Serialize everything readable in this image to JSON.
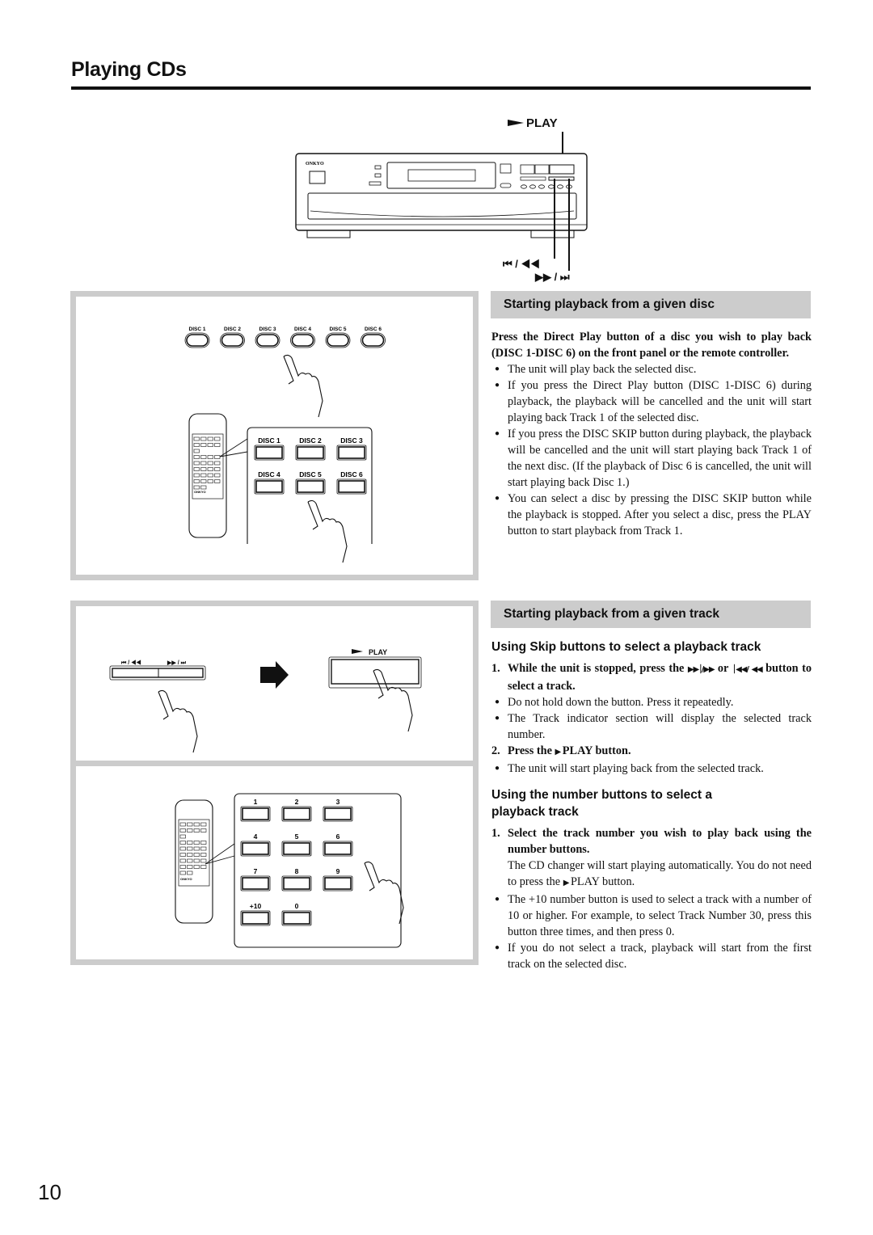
{
  "page": {
    "title": "Playing CDs",
    "page_number": "10"
  },
  "top_figure": {
    "brand": "ONKYO",
    "play_label": "PLAY",
    "prev_label": "⏮ / ◀◀",
    "next_label": "▶▶ / ⏭",
    "icons": [
      "play-icon",
      "skip-back-icon",
      "rewind-icon",
      "fast-forward-icon",
      "skip-forward-icon"
    ]
  },
  "disc_figure": {
    "front_panel_buttons": [
      "DISC 1",
      "DISC 2",
      "DISC 3",
      "DISC 4",
      "DISC 5",
      "DISC 6"
    ],
    "remote_buttons": [
      "DISC 1",
      "DISC 2",
      "DISC 3",
      "DISC 4",
      "DISC 5",
      "DISC 6"
    ],
    "remote_brand": "ONKYO"
  },
  "skip_figure": {
    "prev_label": "⏮ / ◀◀",
    "next_label": "▶▶ / ⏭",
    "play_label": "PLAY"
  },
  "number_figure": {
    "buttons": [
      "1",
      "2",
      "3",
      "4",
      "5",
      "6",
      "7",
      "8",
      "9",
      "+10",
      "0"
    ],
    "remote_brand": "ONKYO"
  },
  "section_disc": {
    "heading": "Starting playback from a given disc",
    "intro": "Press the Direct Play button of a disc you wish to play back (DISC 1-DISC 6) on the front panel or the remote controller.",
    "bullets": [
      "The unit will play back the selected disc.",
      "If you press the Direct Play button (DISC 1-DISC 6) during playback, the playback will be cancelled and the unit will start playing back Track 1 of the selected disc.",
      "If you press the DISC SKIP button during playback, the playback will be cancelled and the unit will start playing back Track 1 of the next disc. (If the playback of Disc 6 is cancelled, the unit will start playing back Disc 1.)",
      "You can select a disc by pressing the DISC SKIP button while the playback is stopped. After you select a disc, press the PLAY button to start playback from Track 1."
    ]
  },
  "section_track": {
    "heading": "Starting playback from a given track",
    "skip_sub": {
      "heading": "Using Skip buttons to select a playback track",
      "step1_num": "1.",
      "step1_a": "While the unit is stopped, press the",
      "step1_glyph1": "▶▶⏐/▶▶",
      "step1_or": "or",
      "step1_glyph2": "⏐◀◀/",
      "step1_glyph3": "◀◀",
      "step1_b": "button to select a track.",
      "bullets": [
        "Do not hold down the button. Press it repeatedly.",
        "The Track indicator section will display the selected track number."
      ],
      "step2_num": "2.",
      "step2_a": "Press the",
      "step2_glyph": "▶",
      "step2_b": "PLAY button.",
      "bullets2": [
        "The unit will start playing back from the selected track."
      ]
    },
    "number_sub": {
      "heading": "Using the number buttons to select a playback track",
      "step1_num": "1.",
      "step1": "Select the track number you wish to play back using the number buttons.",
      "step1_note_a": "The CD changer will start playing automatically. You do not need to press the",
      "step1_note_glyph": "▶",
      "step1_note_b": "PLAY button.",
      "bullets": [
        "The +10 number button is used to select a track with a number of 10 or higher. For example, to select Track Number 30, press this button three times, and then press 0.",
        "If you do not select a track, playback will start from the first track on the selected disc."
      ]
    }
  },
  "colors": {
    "panel_border": "#cccccc",
    "section_bar": "#cccccc",
    "ink": "#111111"
  }
}
